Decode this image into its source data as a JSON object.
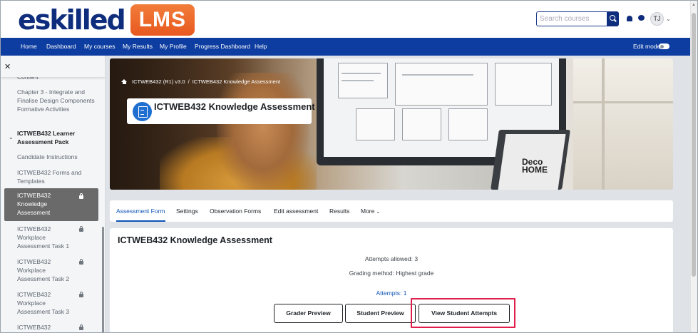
{
  "header": {
    "logo_text": "eskilled",
    "logo_badge": "LMS",
    "search_placeholder": "Search courses",
    "avatar_initials": "TJ"
  },
  "nav": {
    "items": [
      "Home",
      "Dashboard",
      "My courses",
      "My Results",
      "My Profile",
      "Progress Dashboard",
      "Help"
    ],
    "edit_mode": "Edit mode"
  },
  "drawer": {
    "cut_off": "Content",
    "items": [
      {
        "label": "Chapter 3 - Integrate and Finalise Design Components Formative Activities"
      },
      {
        "label": "ICTWEB432 Learner Assessment Pack"
      },
      {
        "label": "Candidate Instructions"
      },
      {
        "label": "ICTWEB432 Forms and Templates"
      },
      {
        "label": "ICTWEB432 Knowledge Assessment"
      },
      {
        "label": "ICTWEB432 Workplace Assessment Task 1"
      },
      {
        "label": "ICTWEB432 Workplace Assessment Task 2"
      },
      {
        "label": "ICTWEB432 Workplace Assessment Task 3"
      },
      {
        "label": "ICTWEB432"
      }
    ]
  },
  "hero": {
    "breadcrumb": [
      "ICTWEB432 (R1) v3.0",
      "/",
      "ICTWEB432 Knowledge Assessment"
    ],
    "title": "ICTWEB432 Knowledge Assessment",
    "laptop_text": "Deco HOME"
  },
  "tabs": [
    "Assessment Form",
    "Settings",
    "Observation Forms",
    "Edit assessment",
    "Results",
    "More"
  ],
  "main": {
    "title": "ICTWEB432 Knowledge Assessment",
    "attempts_allowed": "Attempts allowed: 3",
    "grading_method": "Grading method: Highest grade",
    "attempts_link": "Attempts: 1",
    "buttons": [
      "Grader Preview",
      "Student Preview",
      "View Student Attempts"
    ]
  },
  "colors": {
    "brand_navy": "#0f2d7d",
    "nav_blue": "#0d3da0",
    "lms_orange": "#e8581f",
    "link_blue": "#0f55b7",
    "highlight_red": "#e01e4b"
  }
}
